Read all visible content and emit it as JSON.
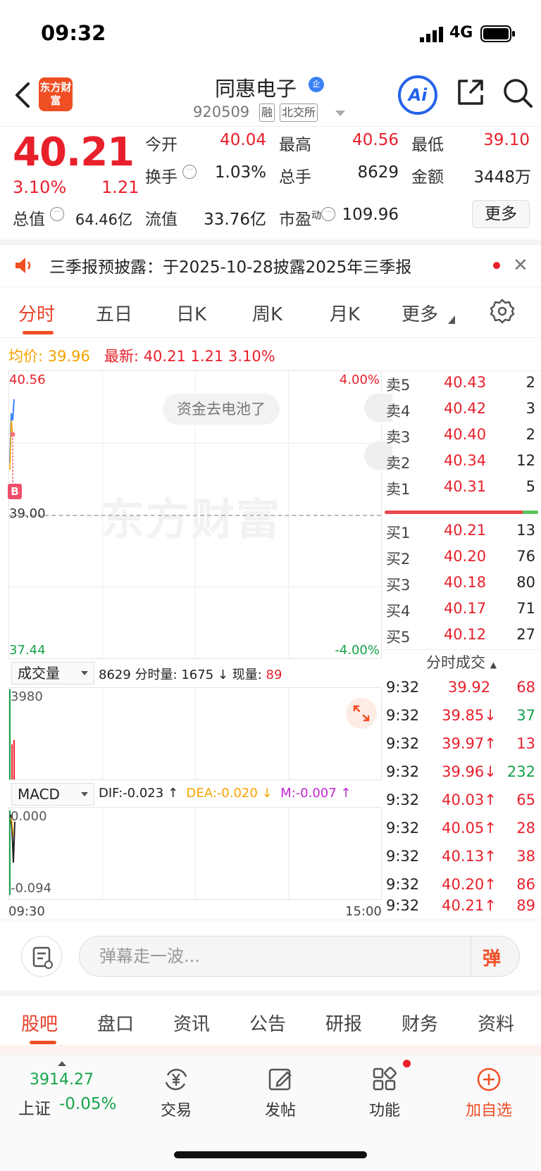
{
  "status": {
    "time": "09:32",
    "network": "4G"
  },
  "header": {
    "logo_text": "东方财富",
    "stock_name": "同惠电子",
    "name_badge": "企",
    "stock_code": "920509",
    "tag_margin": "融",
    "tag_exchange": "北交所",
    "ai_label": "Ai"
  },
  "quote": {
    "last_price": "40.21",
    "change_pct": "3.10%",
    "change": "1.21",
    "open_label": "今开",
    "open": "40.04",
    "high_label": "最高",
    "high": "40.56",
    "low_label": "最低",
    "low": "39.10",
    "turnover_label": "换手",
    "turnover": "1.03%",
    "volume_label": "总手",
    "volume": "8629",
    "amount_label": "金额",
    "amount": "3448万",
    "mktcap_label": "总值",
    "mktcap": "64.46亿",
    "float_label": "流值",
    "float_cap": "33.76亿",
    "pe_label": "市盈",
    "pe_sup": "动",
    "pe": "109.96",
    "more_label": "更多"
  },
  "notice": {
    "text": "三季报预披露：于2025-10-28披露2025年三季报"
  },
  "chart_tabs": [
    "分时",
    "五日",
    "日K",
    "周K",
    "月K",
    "更多"
  ],
  "avg": {
    "avg_label": "均价:",
    "avg_value": "39.96",
    "latest_label": "最新:",
    "latest_value": "40.21",
    "latest_change": "1.21",
    "latest_pct": "3.10%"
  },
  "price_chart": {
    "y_top": "40.56",
    "y_mid": "39.00",
    "y_bottom": "37.44",
    "pct_top": "4.00%",
    "pct_bottom": "-4.00%",
    "watermark": "东方财富",
    "danmaku": "资金去电池了",
    "marker": "B"
  },
  "volume": {
    "selector": "成交量",
    "total": "8629",
    "minute_label": "分时量:",
    "minute_value": "1675",
    "now_label": "现量:",
    "now_value": "89",
    "y_label": "3980"
  },
  "macd": {
    "selector": "MACD",
    "dif": "DIF:-0.023",
    "dea": "DEA:-0.020",
    "m": "M:-0.007",
    "y_top": "0.000",
    "y_bottom": "-0.094"
  },
  "time_axis": {
    "start": "09:30",
    "end": "15:00"
  },
  "order_book": {
    "asks": [
      {
        "label": "卖5",
        "price": "40.43",
        "qty": "2"
      },
      {
        "label": "卖4",
        "price": "40.42",
        "qty": "3"
      },
      {
        "label": "卖3",
        "price": "40.40",
        "qty": "2"
      },
      {
        "label": "卖2",
        "price": "40.34",
        "qty": "12"
      },
      {
        "label": "卖1",
        "price": "40.31",
        "qty": "5"
      }
    ],
    "bids": [
      {
        "label": "买1",
        "price": "40.21",
        "qty": "13"
      },
      {
        "label": "买2",
        "price": "40.20",
        "qty": "76"
      },
      {
        "label": "买3",
        "price": "40.18",
        "qty": "80"
      },
      {
        "label": "买4",
        "price": "40.17",
        "qty": "71"
      },
      {
        "label": "买5",
        "price": "40.12",
        "qty": "27"
      }
    ]
  },
  "trades": {
    "title": "分时成交",
    "rows": [
      {
        "time": "9:32",
        "price": "39.92",
        "vol": "68",
        "dir": "",
        "color": "red"
      },
      {
        "time": "9:32",
        "price": "39.85↓",
        "vol": "37",
        "dir": "down",
        "color": "green"
      },
      {
        "time": "9:32",
        "price": "39.97↑",
        "vol": "13",
        "dir": "up",
        "color": "red"
      },
      {
        "time": "9:32",
        "price": "39.96↓",
        "vol": "232",
        "dir": "down",
        "color": "green"
      },
      {
        "time": "9:32",
        "price": "40.03↑",
        "vol": "65",
        "dir": "up",
        "color": "red"
      },
      {
        "time": "9:32",
        "price": "40.05↑",
        "vol": "28",
        "dir": "up",
        "color": "red"
      },
      {
        "time": "9:32",
        "price": "40.13↑",
        "vol": "38",
        "dir": "up",
        "color": "red"
      },
      {
        "time": "9:32",
        "price": "40.20↑",
        "vol": "86",
        "dir": "up",
        "color": "red"
      },
      {
        "time": "9:32",
        "price": "40.21↑",
        "vol": "89",
        "dir": "up",
        "color": "red"
      }
    ]
  },
  "comment": {
    "placeholder": "弹幕走一波...",
    "danmaku_btn": "弹"
  },
  "bottom_tabs": [
    "股吧",
    "盘口",
    "资讯",
    "公告",
    "研报",
    "财务",
    "资料"
  ],
  "bottom_nav": {
    "index_value": "3914.27",
    "index_label": "上证",
    "index_change": "-0.05%",
    "items": [
      {
        "label": "交易",
        "icon": "yen-exchange-icon"
      },
      {
        "label": "发帖",
        "icon": "edit-post-icon"
      },
      {
        "label": "功能",
        "icon": "grid-apps-icon"
      },
      {
        "label": "加自选",
        "icon": "plus-circle-icon"
      }
    ]
  },
  "colors": {
    "up": "#e8202b",
    "down": "#16a34a",
    "accent": "#f04e23",
    "ai_blue": "#2563eb"
  }
}
